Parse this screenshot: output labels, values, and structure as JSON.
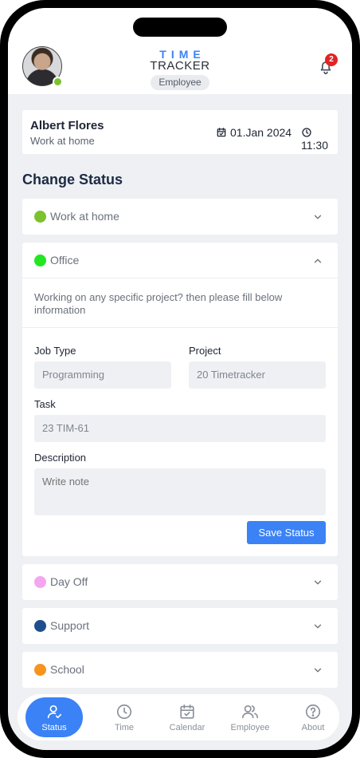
{
  "header": {
    "logo_line1": "TIME",
    "logo_line2": "TRACKER",
    "role_badge": "Employee",
    "notification_count": "2"
  },
  "employee": {
    "name": "Albert Flores",
    "status": "Work at home",
    "date": "01.Jan 2024",
    "time": "11:30"
  },
  "section_title": "Change Status",
  "statuses": [
    {
      "label": "Work at home",
      "color": "#7cc22e",
      "expanded": false
    },
    {
      "label": "Office",
      "color": "#22e622",
      "expanded": true
    },
    {
      "label": "Day Off",
      "color": "#f4a6f0",
      "expanded": false
    },
    {
      "label": "Support",
      "color": "#1e4f8c",
      "expanded": false
    },
    {
      "label": "School",
      "color": "#f7941d",
      "expanded": false
    }
  ],
  "office_form": {
    "hint": "Working on any specific project? then please fill below information",
    "job_type_label": "Job Type",
    "job_type_value": "Programming",
    "project_label": "Project",
    "project_value": "20 Timetracker",
    "task_label": "Task",
    "task_value": "23 TIM-61",
    "description_label": "Description",
    "description_placeholder": "Write note",
    "save_label": "Save Status"
  },
  "nav": {
    "items": [
      {
        "label": "Status",
        "icon": "user-check-icon",
        "active": true
      },
      {
        "label": "Time",
        "icon": "clock-icon",
        "active": false
      },
      {
        "label": "Calendar",
        "icon": "calendar-check-icon",
        "active": false
      },
      {
        "label": "Employee",
        "icon": "users-icon",
        "active": false
      },
      {
        "label": "About",
        "icon": "question-circle-icon",
        "active": false
      }
    ]
  },
  "colors": {
    "accent": "#3b82f6",
    "online": "#7cc22e",
    "notification": "#e02424"
  }
}
